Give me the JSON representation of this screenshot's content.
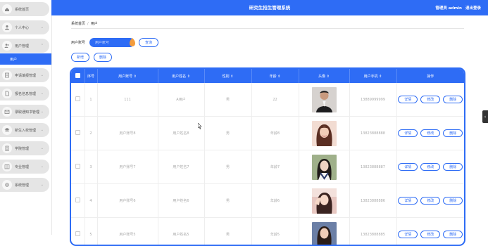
{
  "header": {
    "title": "研究生招生管理系统",
    "user": "管理员 admin",
    "logout": "退出登录"
  },
  "sidebar": {
    "items": [
      {
        "label": "系统首页",
        "icon": "home-icon",
        "caret": ""
      },
      {
        "label": "个人中心",
        "icon": "user-icon",
        "caret": "⌄"
      },
      {
        "label": "用户管理",
        "icon": "users-icon",
        "caret": "⌃"
      },
      {
        "label": "申请填报管理",
        "icon": "form-icon",
        "caret": "⌄"
      },
      {
        "label": "报名信息管理",
        "icon": "file-icon",
        "caret": "⌄"
      },
      {
        "label": "录取通知书管理",
        "icon": "mail-icon",
        "caret": "⌄"
      },
      {
        "label": "新生入校管理",
        "icon": "school-icon",
        "caret": "⌄"
      },
      {
        "label": "学院管理",
        "icon": "building-icon",
        "caret": "⌄"
      },
      {
        "label": "专业管理",
        "icon": "book-icon",
        "caret": "⌄"
      },
      {
        "label": "系统管理",
        "icon": "gear-icon",
        "caret": "⌄"
      }
    ],
    "sub_active": "用户"
  },
  "breadcrumb": {
    "home": "系统首页",
    "sep": "/",
    "current": "用户"
  },
  "search": {
    "label": "用户账号",
    "placeholder": "用户账号",
    "button": "查询"
  },
  "actions": {
    "add": "新增",
    "delete": "删除"
  },
  "table": {
    "columns": [
      "",
      "序号",
      "用户账号 ⇕",
      "用户姓名 ⇕",
      "性别 ⇕",
      "年龄 ⇕",
      "头像 ⇕",
      "用户手机 ⇕",
      "操作"
    ],
    "rows": [
      {
        "no": "1",
        "account": "111",
        "name": "A用户",
        "gender": "男",
        "age": "22",
        "phone": "13889999999",
        "avatar": "man-dark"
      },
      {
        "no": "2",
        "account": "用户账号8",
        "name": "用户姓名8",
        "gender": "男",
        "age": "年龄8",
        "phone": "13823888888",
        "avatar": "woman-1"
      },
      {
        "no": "3",
        "account": "用户账号7",
        "name": "用户姓名7",
        "gender": "男",
        "age": "年龄7",
        "phone": "13823888887",
        "avatar": "woman-2"
      },
      {
        "no": "4",
        "account": "用户账号6",
        "name": "用户姓名6",
        "gender": "男",
        "age": "年龄6",
        "phone": "13823888886",
        "avatar": "woman-3"
      },
      {
        "no": "5",
        "account": "用户账号5",
        "name": "用户姓名5",
        "gender": "男",
        "age": "年龄5",
        "phone": "13823888885",
        "avatar": "woman-4"
      }
    ],
    "ops": {
      "detail": "详情",
      "edit": "修改",
      "delete": "删除"
    }
  },
  "colors": {
    "primary": "#2e6cf5",
    "sidebar_pill": "#e5e5e5"
  }
}
